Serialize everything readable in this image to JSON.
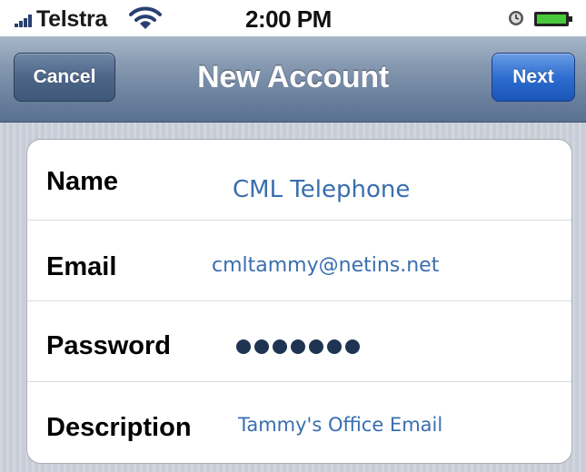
{
  "status_bar": {
    "carrier": "Telstra",
    "time": "2:00 PM",
    "icons": [
      "signal-icon",
      "wifi-icon",
      "alarm-icon",
      "battery-icon"
    ]
  },
  "nav": {
    "cancel_label": "Cancel",
    "title": "New Account",
    "next_label": "Next"
  },
  "form": {
    "name": {
      "label": "Name",
      "value": "CML Telephone"
    },
    "email": {
      "label": "Email",
      "value": "cmltammy@netins.net"
    },
    "password": {
      "label": "Password",
      "masked_length": 7
    },
    "description": {
      "label": "Description",
      "value": "Tammy's Office Email"
    }
  },
  "colors": {
    "nav_bar": "#7e93ad",
    "next_button": "#2f6dd0",
    "field_value": "#3a6eae",
    "background": "#c7ccd6"
  }
}
